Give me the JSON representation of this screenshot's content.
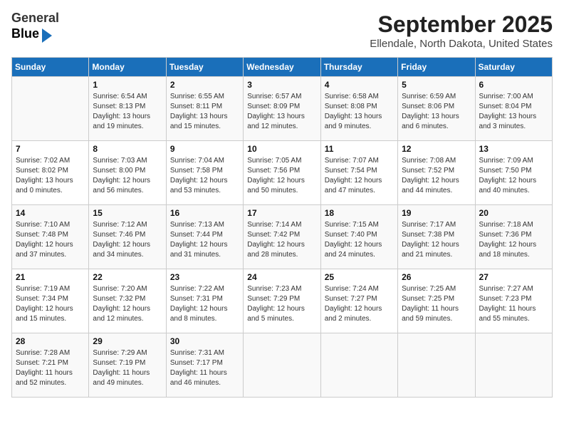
{
  "header": {
    "logo_general": "General",
    "logo_blue": "Blue",
    "title": "September 2025",
    "location": "Ellendale, North Dakota, United States"
  },
  "days_of_week": [
    "Sunday",
    "Monday",
    "Tuesday",
    "Wednesday",
    "Thursday",
    "Friday",
    "Saturday"
  ],
  "weeks": [
    [
      {
        "day": "",
        "info": ""
      },
      {
        "day": "1",
        "info": "Sunrise: 6:54 AM\nSunset: 8:13 PM\nDaylight: 13 hours\nand 19 minutes."
      },
      {
        "day": "2",
        "info": "Sunrise: 6:55 AM\nSunset: 8:11 PM\nDaylight: 13 hours\nand 15 minutes."
      },
      {
        "day": "3",
        "info": "Sunrise: 6:57 AM\nSunset: 8:09 PM\nDaylight: 13 hours\nand 12 minutes."
      },
      {
        "day": "4",
        "info": "Sunrise: 6:58 AM\nSunset: 8:08 PM\nDaylight: 13 hours\nand 9 minutes."
      },
      {
        "day": "5",
        "info": "Sunrise: 6:59 AM\nSunset: 8:06 PM\nDaylight: 13 hours\nand 6 minutes."
      },
      {
        "day": "6",
        "info": "Sunrise: 7:00 AM\nSunset: 8:04 PM\nDaylight: 13 hours\nand 3 minutes."
      }
    ],
    [
      {
        "day": "7",
        "info": "Sunrise: 7:02 AM\nSunset: 8:02 PM\nDaylight: 13 hours\nand 0 minutes."
      },
      {
        "day": "8",
        "info": "Sunrise: 7:03 AM\nSunset: 8:00 PM\nDaylight: 12 hours\nand 56 minutes."
      },
      {
        "day": "9",
        "info": "Sunrise: 7:04 AM\nSunset: 7:58 PM\nDaylight: 12 hours\nand 53 minutes."
      },
      {
        "day": "10",
        "info": "Sunrise: 7:05 AM\nSunset: 7:56 PM\nDaylight: 12 hours\nand 50 minutes."
      },
      {
        "day": "11",
        "info": "Sunrise: 7:07 AM\nSunset: 7:54 PM\nDaylight: 12 hours\nand 47 minutes."
      },
      {
        "day": "12",
        "info": "Sunrise: 7:08 AM\nSunset: 7:52 PM\nDaylight: 12 hours\nand 44 minutes."
      },
      {
        "day": "13",
        "info": "Sunrise: 7:09 AM\nSunset: 7:50 PM\nDaylight: 12 hours\nand 40 minutes."
      }
    ],
    [
      {
        "day": "14",
        "info": "Sunrise: 7:10 AM\nSunset: 7:48 PM\nDaylight: 12 hours\nand 37 minutes."
      },
      {
        "day": "15",
        "info": "Sunrise: 7:12 AM\nSunset: 7:46 PM\nDaylight: 12 hours\nand 34 minutes."
      },
      {
        "day": "16",
        "info": "Sunrise: 7:13 AM\nSunset: 7:44 PM\nDaylight: 12 hours\nand 31 minutes."
      },
      {
        "day": "17",
        "info": "Sunrise: 7:14 AM\nSunset: 7:42 PM\nDaylight: 12 hours\nand 28 minutes."
      },
      {
        "day": "18",
        "info": "Sunrise: 7:15 AM\nSunset: 7:40 PM\nDaylight: 12 hours\nand 24 minutes."
      },
      {
        "day": "19",
        "info": "Sunrise: 7:17 AM\nSunset: 7:38 PM\nDaylight: 12 hours\nand 21 minutes."
      },
      {
        "day": "20",
        "info": "Sunrise: 7:18 AM\nSunset: 7:36 PM\nDaylight: 12 hours\nand 18 minutes."
      }
    ],
    [
      {
        "day": "21",
        "info": "Sunrise: 7:19 AM\nSunset: 7:34 PM\nDaylight: 12 hours\nand 15 minutes."
      },
      {
        "day": "22",
        "info": "Sunrise: 7:20 AM\nSunset: 7:32 PM\nDaylight: 12 hours\nand 12 minutes."
      },
      {
        "day": "23",
        "info": "Sunrise: 7:22 AM\nSunset: 7:31 PM\nDaylight: 12 hours\nand 8 minutes."
      },
      {
        "day": "24",
        "info": "Sunrise: 7:23 AM\nSunset: 7:29 PM\nDaylight: 12 hours\nand 5 minutes."
      },
      {
        "day": "25",
        "info": "Sunrise: 7:24 AM\nSunset: 7:27 PM\nDaylight: 12 hours\nand 2 minutes."
      },
      {
        "day": "26",
        "info": "Sunrise: 7:25 AM\nSunset: 7:25 PM\nDaylight: 11 hours\nand 59 minutes."
      },
      {
        "day": "27",
        "info": "Sunrise: 7:27 AM\nSunset: 7:23 PM\nDaylight: 11 hours\nand 55 minutes."
      }
    ],
    [
      {
        "day": "28",
        "info": "Sunrise: 7:28 AM\nSunset: 7:21 PM\nDaylight: 11 hours\nand 52 minutes."
      },
      {
        "day": "29",
        "info": "Sunrise: 7:29 AM\nSunset: 7:19 PM\nDaylight: 11 hours\nand 49 minutes."
      },
      {
        "day": "30",
        "info": "Sunrise: 7:31 AM\nSunset: 7:17 PM\nDaylight: 11 hours\nand 46 minutes."
      },
      {
        "day": "",
        "info": ""
      },
      {
        "day": "",
        "info": ""
      },
      {
        "day": "",
        "info": ""
      },
      {
        "day": "",
        "info": ""
      }
    ]
  ]
}
